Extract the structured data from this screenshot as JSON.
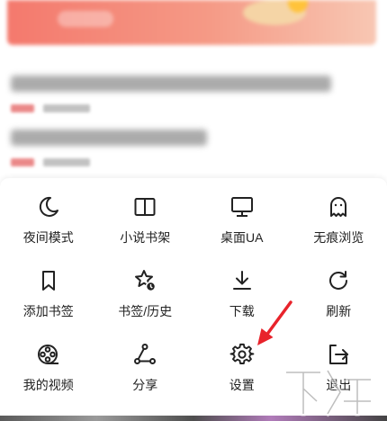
{
  "menu": {
    "items": [
      {
        "label": "夜间模式",
        "icon": "moon-icon"
      },
      {
        "label": "小说书架",
        "icon": "book-icon"
      },
      {
        "label": "桌面UA",
        "icon": "monitor-icon"
      },
      {
        "label": "无痕浏览",
        "icon": "ghost-icon"
      },
      {
        "label": "添加书签",
        "icon": "bookmark-icon"
      },
      {
        "label": "书签/历史",
        "icon": "star-history-icon"
      },
      {
        "label": "下载",
        "icon": "download-icon"
      },
      {
        "label": "刷新",
        "icon": "refresh-icon"
      },
      {
        "label": "我的视频",
        "icon": "film-reel-icon"
      },
      {
        "label": "分享",
        "icon": "share-icon"
      },
      {
        "label": "设置",
        "icon": "gear-icon"
      },
      {
        "label": "退出",
        "icon": "exit-icon"
      }
    ]
  },
  "colors": {
    "icon": "#222222",
    "annotation_arrow": "#e8232b",
    "banner": "#f4796d"
  }
}
